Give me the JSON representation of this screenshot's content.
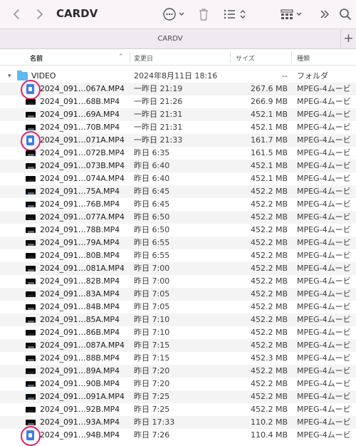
{
  "window": {
    "title": "CARDV",
    "tab_label": "CARDV"
  },
  "columns": {
    "name": "名前",
    "date": "変更日",
    "size": "サイズ",
    "kind": "種類"
  },
  "folder": {
    "name": "VIDEO",
    "date": "2024年8月11日 18:16",
    "size": "--",
    "kind": "フォルダ"
  },
  "files": [
    {
      "name": "2024_091…067A.MP4",
      "date": "一昨日 21:19",
      "size": "267.6 MB",
      "kind": "MPEG-4ムービ",
      "icon": "doc",
      "circled": true
    },
    {
      "name": "2024_091…68B.MP4",
      "date": "一昨日 21:26",
      "size": "266.9 MB",
      "kind": "MPEG-4ムービ",
      "icon": "thumb",
      "circled": false
    },
    {
      "name": "2024_091…69A.MP4",
      "date": "一昨日 21:31",
      "size": "452.1 MB",
      "kind": "MPEG-4ムービ",
      "icon": "thumb",
      "circled": false
    },
    {
      "name": "2024_091…70B.MP4",
      "date": "一昨日 21:31",
      "size": "452.1 MB",
      "kind": "MPEG-4ムービ",
      "icon": "thumb",
      "circled": false
    },
    {
      "name": "2024_091…071A.MP4",
      "date": "一昨日 21:33",
      "size": "161.7 MB",
      "kind": "MPEG-4ムービ",
      "icon": "doc",
      "circled": true
    },
    {
      "name": "2024_091…072B.MP4",
      "date": "昨日 6:35",
      "size": "161.5 MB",
      "kind": "MPEG-4ムービ",
      "icon": "thumb",
      "circled": false
    },
    {
      "name": "2024_091…073B.MP4",
      "date": "昨日 6:40",
      "size": "452.1 MB",
      "kind": "MPEG-4ムービ",
      "icon": "thumb",
      "circled": false
    },
    {
      "name": "2024_091…074A.MP4",
      "date": "昨日 6:40",
      "size": "452.1 MB",
      "kind": "MPEG-4ムービ",
      "icon": "thumb",
      "circled": false
    },
    {
      "name": "2024_091…75A.MP4",
      "date": "昨日 6:45",
      "size": "452.2 MB",
      "kind": "MPEG-4ムービ",
      "icon": "thumb",
      "circled": false
    },
    {
      "name": "2024_091…76B.MP4",
      "date": "昨日 6:45",
      "size": "452.2 MB",
      "kind": "MPEG-4ムービ",
      "icon": "thumb",
      "circled": false
    },
    {
      "name": "2024_091…077A.MP4",
      "date": "昨日 6:50",
      "size": "452.2 MB",
      "kind": "MPEG-4ムービ",
      "icon": "thumb",
      "circled": false
    },
    {
      "name": "2024_091…78B.MP4",
      "date": "昨日 6:50",
      "size": "452.2 MB",
      "kind": "MPEG-4ムービ",
      "icon": "thumb",
      "circled": false
    },
    {
      "name": "2024_091…79A.MP4",
      "date": "昨日 6:55",
      "size": "452.2 MB",
      "kind": "MPEG-4ムービ",
      "icon": "thumb",
      "circled": false
    },
    {
      "name": "2024_091…80B.MP4",
      "date": "昨日 6:55",
      "size": "452.2 MB",
      "kind": "MPEG-4ムービ",
      "icon": "thumb",
      "circled": false
    },
    {
      "name": "2024_091…081A.MP4",
      "date": "昨日 7:00",
      "size": "452.2 MB",
      "kind": "MPEG-4ムービ",
      "icon": "thumb",
      "circled": false
    },
    {
      "name": "2024_091…82B.MP4",
      "date": "昨日 7:00",
      "size": "452.2 MB",
      "kind": "MPEG-4ムービ",
      "icon": "thumb",
      "circled": false
    },
    {
      "name": "2024_091…83A.MP4",
      "date": "昨日 7:05",
      "size": "452.2 MB",
      "kind": "MPEG-4ムービ",
      "icon": "thumb",
      "circled": false
    },
    {
      "name": "2024_091…84B.MP4",
      "date": "昨日 7:05",
      "size": "452.2 MB",
      "kind": "MPEG-4ムービ",
      "icon": "thumb",
      "circled": false
    },
    {
      "name": "2024_091…85A.MP4",
      "date": "昨日 7:10",
      "size": "452.2 MB",
      "kind": "MPEG-4ムービ",
      "icon": "thumb",
      "circled": false
    },
    {
      "name": "2024_091…86B.MP4",
      "date": "昨日 7:10",
      "size": "452.2 MB",
      "kind": "MPEG-4ムービ",
      "icon": "thumb",
      "circled": false
    },
    {
      "name": "2024_091…087A.MP4",
      "date": "昨日 7:15",
      "size": "452.2 MB",
      "kind": "MPEG-4ムービ",
      "icon": "thumb",
      "circled": false
    },
    {
      "name": "2024_091…88B.MP4",
      "date": "昨日 7:15",
      "size": "452.3 MB",
      "kind": "MPEG-4ムービ",
      "icon": "thumb",
      "circled": false
    },
    {
      "name": "2024_091…89A.MP4",
      "date": "昨日 7:20",
      "size": "452.2 MB",
      "kind": "MPEG-4ムービ",
      "icon": "thumb",
      "circled": false
    },
    {
      "name": "2024_091…90B.MP4",
      "date": "昨日 7:20",
      "size": "452.2 MB",
      "kind": "MPEG-4ムービ",
      "icon": "thumb",
      "circled": false
    },
    {
      "name": "2024_091…091A.MP4",
      "date": "昨日 7:25",
      "size": "452.2 MB",
      "kind": "MPEG-4ムービ",
      "icon": "thumb",
      "circled": false
    },
    {
      "name": "2024_091…92B.MP4",
      "date": "昨日 7:25",
      "size": "452.2 MB",
      "kind": "MPEG-4ムービ",
      "icon": "thumb",
      "circled": false
    },
    {
      "name": "2024_091…93A.MP4",
      "date": "昨日 17:33",
      "size": "110.2 MB",
      "kind": "MPEG-4ムービ",
      "icon": "thumb",
      "circled": false
    },
    {
      "name": "2024_091…94B.MP4",
      "date": "昨日 7:26",
      "size": "110.4 MB",
      "kind": "MPEG-4ムービ",
      "icon": "doc",
      "circled": true
    }
  ],
  "colors": {
    "accent": "#3f7be8",
    "highlight_ring": "#e0206a",
    "folder": "#5fb8ef"
  },
  "icons": [
    "back-icon",
    "forward-icon",
    "more-icon",
    "trash-icon",
    "list-view-icon",
    "group-icon",
    "chevron-double-right-icon",
    "search-icon"
  ]
}
